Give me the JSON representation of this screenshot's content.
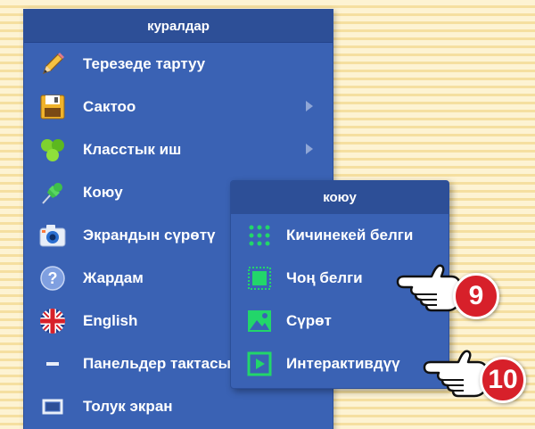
{
  "main_menu": {
    "title": "куралдар",
    "items": [
      {
        "label": "Терезеде тартуу",
        "icon": "pencil-icon",
        "has_submenu": false
      },
      {
        "label": "Сактоо",
        "icon": "floppy-disk-icon",
        "has_submenu": true
      },
      {
        "label": "Класстык иш",
        "icon": "class-work-icon",
        "has_submenu": true
      },
      {
        "label": "Коюу",
        "icon": "pushpin-icon",
        "has_submenu": false
      },
      {
        "label": "Экрандын сүрөтү",
        "icon": "camera-icon",
        "has_submenu": false
      },
      {
        "label": "Жардам",
        "icon": "help-icon",
        "has_submenu": false
      },
      {
        "label": "English",
        "icon": "uk-flag-icon",
        "has_submenu": false
      },
      {
        "label": "Панельдер тактасы",
        "icon": "minus-icon",
        "has_submenu": false
      },
      {
        "label": "Толук экран",
        "icon": "fullscreen-icon",
        "has_submenu": false
      }
    ]
  },
  "sub_menu": {
    "title": "коюу",
    "items": [
      {
        "label": "Кичинекей белги",
        "icon": "small-marker-icon"
      },
      {
        "label": "Чоң белги",
        "icon": "large-marker-icon"
      },
      {
        "label": "Сүрөт",
        "icon": "image-icon"
      },
      {
        "label": "Интерактивдүү",
        "icon": "interactive-play-icon"
      }
    ]
  },
  "callouts": [
    {
      "number": "9",
      "target": "Чоң белги"
    },
    {
      "number": "10",
      "target": "Интерактивдүү"
    }
  ],
  "colors": {
    "menu_bg": "#3a62b4",
    "header_bg": "#2d4f97",
    "accent_green": "#22d66a",
    "badge_red": "#d7202a"
  }
}
